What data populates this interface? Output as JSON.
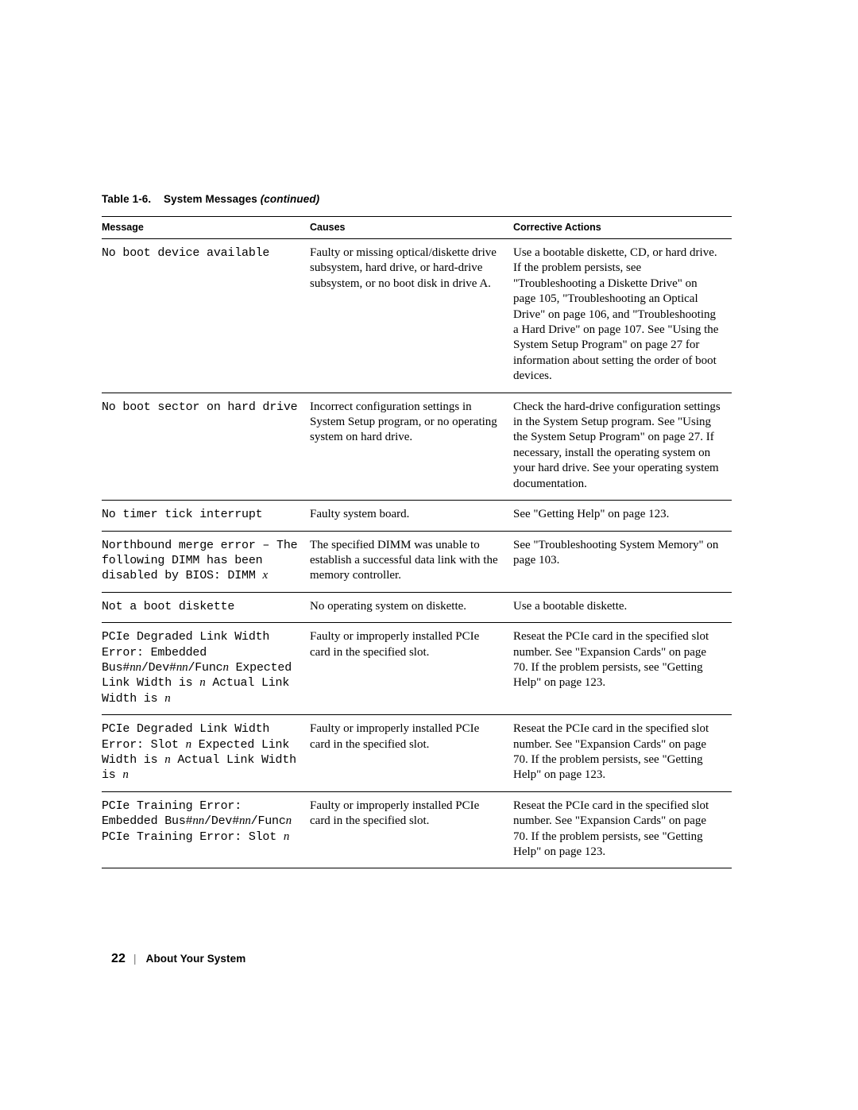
{
  "table": {
    "caption_label": "Table 1-6.",
    "caption_title": "System Messages",
    "caption_continued": "(continued)",
    "headers": {
      "message": "Message",
      "causes": "Causes",
      "corrective": "Corrective Actions"
    },
    "rows": [
      {
        "message": "No boot device available",
        "causes": "Faulty or missing optical/diskette drive subsystem, hard drive, or hard-drive subsystem, or no boot disk in drive A.",
        "corrective": "Use a bootable diskette, CD, or hard drive. If the problem persists, see \"Troubleshooting a Diskette Drive\" on page 105, \"Troubleshooting an Optical Drive\" on page 106, and \"Troubleshooting a Hard Drive\" on page 107. See \"Using the System Setup Program\" on page 27 for information about setting the order of boot devices."
      },
      {
        "message": "No boot sector on hard drive",
        "causes": "Incorrect configuration settings in System Setup program, or no operating system on hard drive.",
        "corrective": "Check the hard-drive configuration settings in the System Setup program. See \"Using the System Setup Program\" on page 27. If necessary, install the operating system on your hard drive. See your operating system documentation."
      },
      {
        "message": "No timer tick interrupt",
        "causes": "Faulty system board.",
        "corrective": "See \"Getting Help\" on page 123."
      },
      {
        "message": "Northbound merge error – The following DIMM has been disabled by BIOS: DIMM x",
        "causes": "The specified DIMM was unable to establish a successful data link with the memory controller.",
        "corrective": "See \"Troubleshooting System Memory\" on page 103."
      },
      {
        "message": "Not a boot diskette",
        "causes": "No operating system on diskette.",
        "corrective": "Use a bootable diskette."
      },
      {
        "message": "PCIe Degraded Link Width Error: Embedded Bus#nn/Dev#nn/Funcn Expected Link Width is n Actual Link Width is n",
        "causes": "Faulty or improperly installed PCIe card in the specified slot.",
        "corrective": "Reseat the PCIe card in the specified slot number. See \"Expansion Cards\" on page 70. If the problem persists, see \"Getting Help\" on page 123."
      },
      {
        "message": "PCIe Degraded Link Width Error: Slot n Expected Link Width is n Actual Link Width is n",
        "causes": "Faulty or improperly installed PCIe card in the specified slot.",
        "corrective": "Reseat the PCIe card in the specified slot number. See \"Expansion Cards\" on page 70. If the problem persists, see \"Getting Help\" on page 123."
      },
      {
        "message": "PCIe Training Error: Embedded Bus#nn/Dev#nn/Funcn PCIe Training Error: Slot n",
        "causes": "Faulty or improperly installed PCIe card in the specified slot.",
        "corrective": "Reseat the PCIe card in the specified slot number. See \"Expansion Cards\" on page 70. If the problem persists, see \"Getting Help\" on page 123."
      }
    ]
  },
  "footer": {
    "page_number": "22",
    "separator": "|",
    "section_title": "About Your System"
  }
}
